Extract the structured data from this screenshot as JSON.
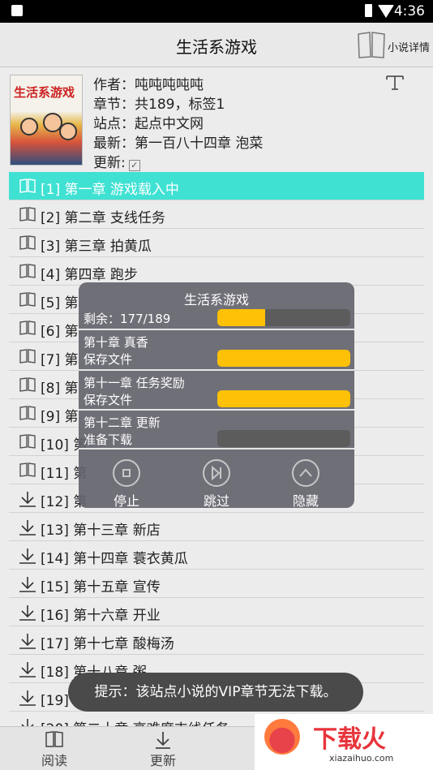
{
  "statusbar": {
    "time": "4:36"
  },
  "header": {
    "title": "生活系游戏",
    "detail_label": "小说详情"
  },
  "book": {
    "cover_title": "生活系游戏",
    "author_line": "作者：吨吨吨吨吨",
    "chapters_line": "章节：共189，标签1",
    "site_line": "站点：起点中文网",
    "latest_line": "最新：第一百八十四章 泡菜",
    "update_label": "更新:",
    "update_checked": true,
    "check_glyph": "✓"
  },
  "chapters": [
    {
      "label": "[1]  第一章 游戏载入中",
      "icon": "book-icon",
      "active": true
    },
    {
      "label": "[2]  第二章 支线任务",
      "icon": "book-icon"
    },
    {
      "label": "[3]  第三章 拍黄瓜",
      "icon": "book-icon"
    },
    {
      "label": "[4]  第四章 跑步",
      "icon": "book-icon"
    },
    {
      "label": "[5]  第",
      "icon": "book-icon"
    },
    {
      "label": "[6]  第",
      "icon": "book-icon"
    },
    {
      "label": "[7]  第",
      "icon": "book-icon"
    },
    {
      "label": "[8]  第",
      "icon": "book-icon"
    },
    {
      "label": "[9]  第",
      "icon": "book-icon"
    },
    {
      "label": "[10]  第",
      "icon": "book-icon"
    },
    {
      "label": "[11]  第",
      "icon": "book-icon"
    },
    {
      "label": "[12]  第",
      "icon": "download-icon"
    },
    {
      "label": "[13]  第十三章 新店",
      "icon": "download-icon"
    },
    {
      "label": "[14]  第十四章 蓑衣黄瓜",
      "icon": "download-icon"
    },
    {
      "label": "[15]  第十五章 宣传",
      "icon": "download-icon"
    },
    {
      "label": "[16]  第十六章 开业",
      "icon": "download-icon"
    },
    {
      "label": "[17]  第十七章 酸梅汤",
      "icon": "download-icon"
    },
    {
      "label": "[18]  第十八章 粥",
      "icon": "download-icon"
    },
    {
      "label": "[19]  第",
      "icon": "download-icon"
    },
    {
      "label": "[20]  第二十章 高难度支线任务",
      "icon": "download-icon"
    }
  ],
  "popup": {
    "title": "生活系游戏",
    "remaining": "剩余：177/189",
    "remaining_progress": 0.36,
    "tasks": [
      {
        "chapter": "第十章 真香",
        "status": "保存文件",
        "progress": 1.0
      },
      {
        "chapter": "第十一章 任务奖励",
        "status": "保存文件",
        "progress": 1.0
      },
      {
        "chapter": "第十二章 更新",
        "status": "准备下载",
        "progress": 0.0
      }
    ],
    "buttons": {
      "stop": "停止",
      "skip": "跳过",
      "hide": "隐藏"
    }
  },
  "toast": "提示：该站点小说的VIP章节无法下载。",
  "bottom_tabs": {
    "read": "阅读",
    "update": "更新"
  },
  "watermark": {
    "text": "下载火",
    "url": "xiazaihuo.com"
  },
  "colors": {
    "active_row": "#3fe1d3",
    "progress": "#ffc107",
    "watermark": "#e8343c"
  }
}
